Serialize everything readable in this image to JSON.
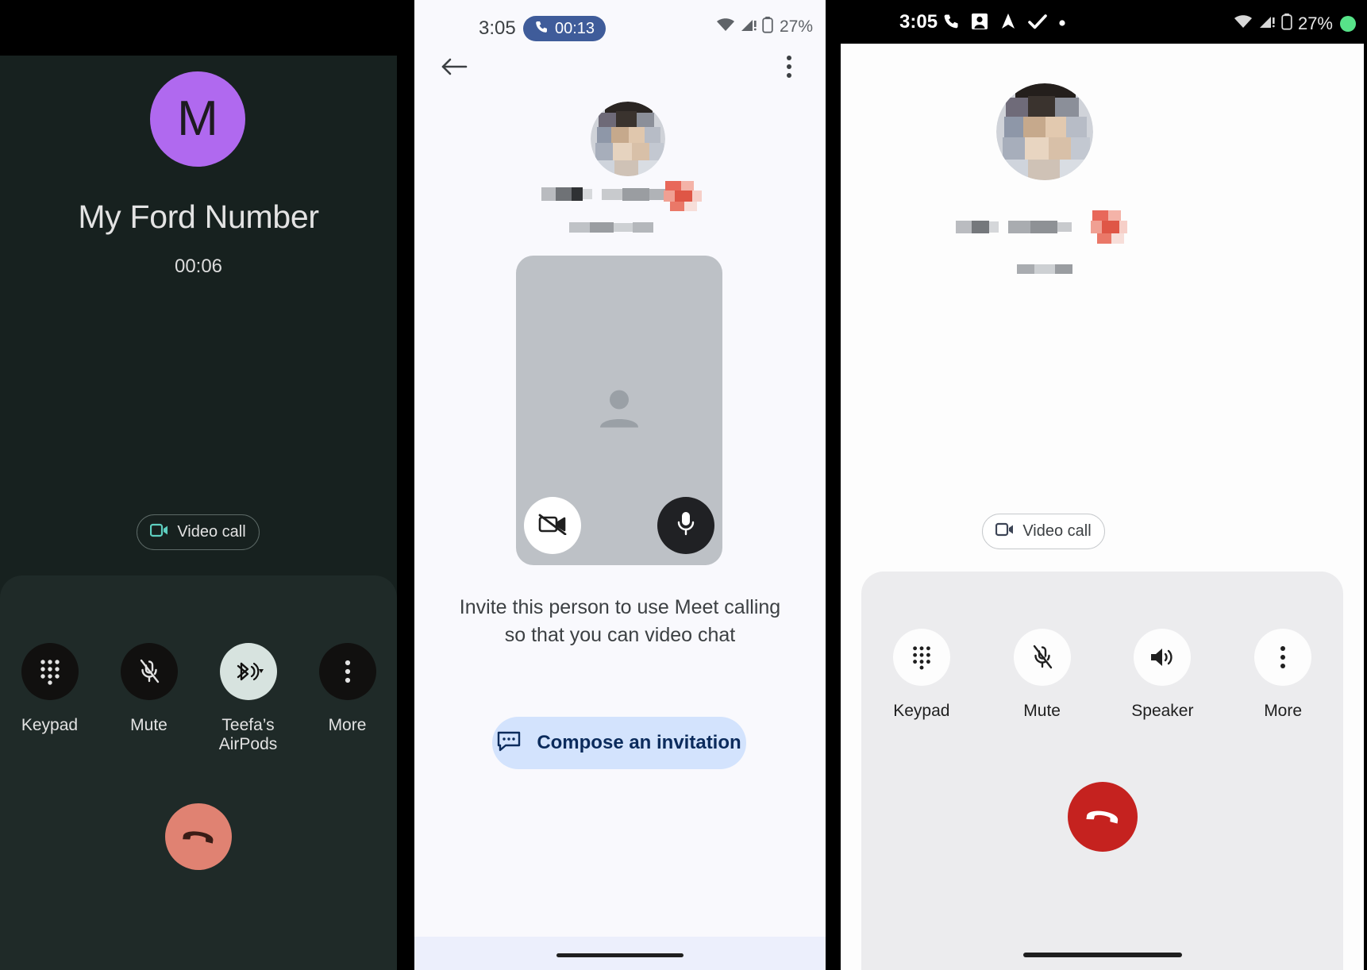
{
  "panels": {
    "left": {
      "name": "dark-in-call",
      "avatar_letter": "M",
      "contact_name": "My Ford Number",
      "call_timer": "00:06",
      "video_call_label": "Video call",
      "controls": [
        {
          "label": "Keypad",
          "icon": "keypad-icon",
          "active": false
        },
        {
          "label": "Mute",
          "icon": "mic-off-icon",
          "active": false
        },
        {
          "label": "Teefa’s AirPods",
          "icon": "bluetooth-audio-icon",
          "active": true
        },
        {
          "label": "More",
          "icon": "more-vertical-icon",
          "active": false
        }
      ],
      "end_call_icon": "call-end-icon",
      "colors": {
        "background": "#17211f",
        "sheet": "#1f2a28",
        "avatar": "#b069ef",
        "end_call": "#e08272",
        "accent": "#a8d8cf"
      }
    },
    "middle": {
      "name": "meet-invite",
      "status_bar": {
        "time": "3:05",
        "call_chip": "00:13",
        "battery": "27%",
        "icons": [
          "phone-icon",
          "wifi-icon",
          "cell-signal-icon",
          "battery-icon"
        ]
      },
      "back_icon": "back-arrow-icon",
      "overflow_icon": "more-vertical-icon",
      "preview": {
        "camera_icon": "video-off-icon",
        "mic_icon": "mic-icon",
        "placeholder_icon": "person-icon"
      },
      "invite_text": "Invite this person to use Meet calling so that you can video chat",
      "compose_label": "Compose an invitation",
      "compose_icon": "message-icon",
      "colors": {
        "background": "#f9f9fd",
        "chip": "#3f5c9a",
        "compose_bg": "#d3e3fd",
        "compose_text": "#0b2b5c",
        "preview": "#bdc1c6"
      }
    },
    "right": {
      "name": "light-in-call",
      "status_bar": {
        "time": "3:05",
        "battery": "27%",
        "left_icons": [
          "phone-icon",
          "app-icon",
          "navigation-icon",
          "check-icon",
          "dot-icon"
        ],
        "right_icons": [
          "wifi-icon",
          "cell-signal-icon",
          "battery-icon",
          "recording-dot-icon"
        ]
      },
      "video_call_label": "Video call",
      "controls": [
        {
          "label": "Keypad",
          "icon": "keypad-icon"
        },
        {
          "label": "Mute",
          "icon": "mic-off-icon"
        },
        {
          "label": "Speaker",
          "icon": "speaker-icon"
        },
        {
          "label": "More",
          "icon": "more-vertical-icon"
        }
      ],
      "end_call_icon": "call-end-icon",
      "colors": {
        "background": "#fdfdfd",
        "sheet": "#ececee",
        "end_call": "#c5221f",
        "status_bar": "#000000"
      }
    }
  }
}
